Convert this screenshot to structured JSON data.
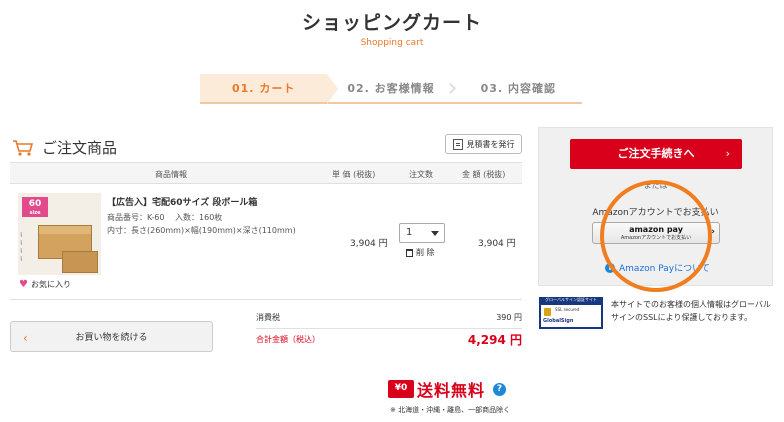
{
  "header": {
    "title": "ショッピングカート",
    "subtitle": "Shopping cart"
  },
  "steps": [
    {
      "label": "01. カート",
      "active": true
    },
    {
      "label": "02. お客様情報",
      "active": false
    },
    {
      "label": "03. 内容確認",
      "active": false
    }
  ],
  "section": {
    "title": "ご注文商品",
    "quote_button": "見積書を発行"
  },
  "table": {
    "headers": {
      "product": "商品情報",
      "unit_price": "単 価 (税抜)",
      "qty": "注文数",
      "amount": "金 額 (税抜)"
    }
  },
  "item": {
    "name": "【広告入】宅配60サイズ 段ボール箱",
    "meta1": "商品番号：K-60　 入数：160枚",
    "meta2": "内寸：長さ(260mm)×幅(190mm)×深さ(110mm)",
    "unit_price": "3,904 円",
    "qty": "1",
    "delete_label": "削 除",
    "total": "3,904 円",
    "favorite_label": "お気に入り",
    "image_badge": "60"
  },
  "continue_button": "お買い物を続ける",
  "summary": {
    "tax_label": "消費税",
    "tax_value": "390 円",
    "total_label": "合計金額（税込）",
    "total_value": "4,294 円"
  },
  "free_shipping": {
    "icon_text": "¥0",
    "label": "送料無料",
    "note": "※ 北海道・沖縄・離島、一部商品除く"
  },
  "sidebar": {
    "checkout_button": "ご注文手続きへ",
    "or_text": "または",
    "amazon_text": "Amazonアカウントでお支払い",
    "amazon_pay_brand": "amazon pay",
    "amazon_pay_sub": "Amazonアカウントでお支払い",
    "amazon_link": "Amazon Payについて"
  },
  "ssl": {
    "badge_title": "グローバルサイン認証サイト",
    "badge_brand": "GlobalSign",
    "badge_secured": "SSL secured",
    "text": "本サイトでのお客様の個人情報はグローバルサインのSSLにより保護しております。"
  },
  "colors": {
    "accent_orange": "#e8782a",
    "checkout_red": "#d9001b",
    "highlight_circle": "#f07d1e",
    "link_blue": "#1e6fd6"
  }
}
